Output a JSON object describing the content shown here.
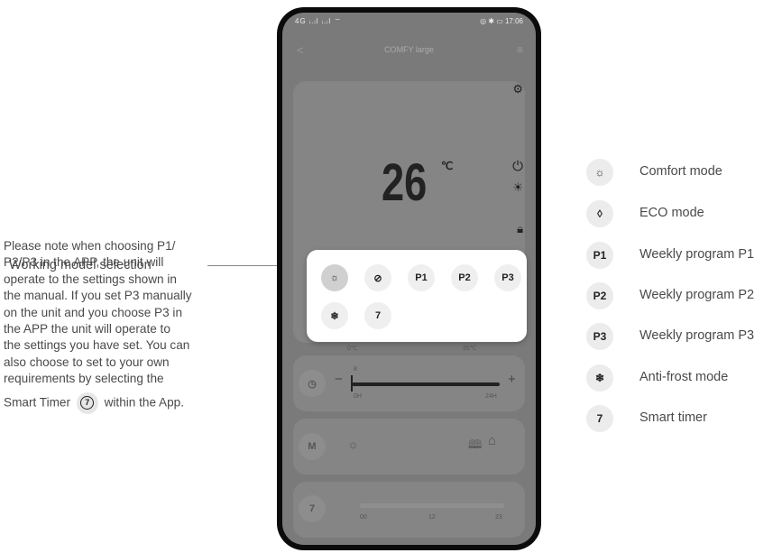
{
  "annotation": {
    "label": "Working model selection"
  },
  "note": {
    "line1": "Please note when choosing P1/",
    "line2": "P2/P3 in the APP, the unit will",
    "line3": "operate to the settings shown in",
    "line4": "the manual. If you set P3 manually",
    "line5": "on the unit and you choose P3 in",
    "line6": "the APP the unit will operate to",
    "line7": "the settings you have set. You can",
    "line8": "also choose to set to your own",
    "line9": "requirements by selecting the",
    "last_before": "Smart Timer",
    "timer_glyph": "7",
    "last_after": "within the App."
  },
  "phone": {
    "status_left": "4G ᵢ.ᵢl ᵢ.ᵢl ⌔",
    "status_right": "◎ ✱ ▭ 17:06",
    "back": "<",
    "title": "COMFY large",
    "menu": "≡",
    "temperature": "26",
    "temp_unit": "℃",
    "popup_modes": [
      "☼",
      "⊘",
      "P1",
      "P2",
      "P3",
      "❄",
      "7"
    ],
    "scale_left": "0℃",
    "scale_right": "35℃",
    "slider_minus": "−",
    "slider_plus": "+",
    "slider_value": "8",
    "slider_start": "0H",
    "slider_end": "24H",
    "mode_button": "M",
    "timer_button": "7",
    "timeline_labels": [
      "00",
      "12",
      "23"
    ]
  },
  "legend": [
    {
      "icon": "☼",
      "icon_name": "sun-icon",
      "label": "Comfort mode"
    },
    {
      "icon": "◊",
      "icon_name": "leaf-icon",
      "label": "ECO mode"
    },
    {
      "icon": "P1",
      "icon_name": "p1-icon",
      "label": "Weekly program P1"
    },
    {
      "icon": "P2",
      "icon_name": "p2-icon",
      "label": "Weekly program P2"
    },
    {
      "icon": "P3",
      "icon_name": "p3-icon",
      "label": "Weekly program P3"
    },
    {
      "icon": "❄",
      "icon_name": "snowflake-icon",
      "label": "Anti-frost mode"
    },
    {
      "icon": "7",
      "icon_name": "timer-icon",
      "label": "Smart timer"
    }
  ]
}
